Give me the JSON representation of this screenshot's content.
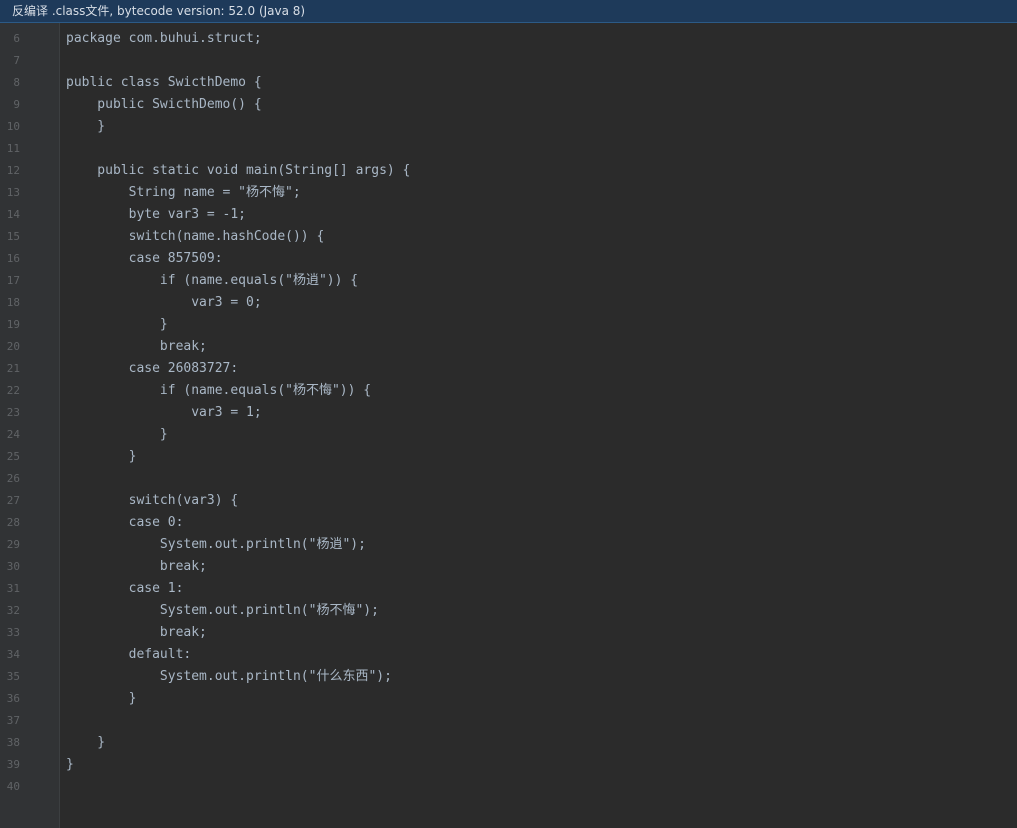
{
  "banner": {
    "text": "反编译 .class文件, bytecode version: 52.0 (Java 8)"
  },
  "editor": {
    "lines": [
      {
        "num": "6",
        "code": "package com.buhui.struct;"
      },
      {
        "num": "7",
        "code": ""
      },
      {
        "num": "8",
        "code": "public class SwicthDemo {"
      },
      {
        "num": "9",
        "code": "    public SwicthDemo() {"
      },
      {
        "num": "10",
        "code": "    }"
      },
      {
        "num": "11",
        "code": ""
      },
      {
        "num": "12",
        "code": "    public static void main(String[] args) {"
      },
      {
        "num": "13",
        "code": "        String name = \"杨不悔\";"
      },
      {
        "num": "14",
        "code": "        byte var3 = -1;"
      },
      {
        "num": "15",
        "code": "        switch(name.hashCode()) {"
      },
      {
        "num": "16",
        "code": "        case 857509:"
      },
      {
        "num": "17",
        "code": "            if (name.equals(\"杨逍\")) {"
      },
      {
        "num": "18",
        "code": "                var3 = 0;"
      },
      {
        "num": "19",
        "code": "            }"
      },
      {
        "num": "20",
        "code": "            break;"
      },
      {
        "num": "21",
        "code": "        case 26083727:"
      },
      {
        "num": "22",
        "code": "            if (name.equals(\"杨不悔\")) {"
      },
      {
        "num": "23",
        "code": "                var3 = 1;"
      },
      {
        "num": "24",
        "code": "            }"
      },
      {
        "num": "25",
        "code": "        }"
      },
      {
        "num": "26",
        "code": ""
      },
      {
        "num": "27",
        "code": "        switch(var3) {"
      },
      {
        "num": "28",
        "code": "        case 0:"
      },
      {
        "num": "29",
        "code": "            System.out.println(\"杨逍\");"
      },
      {
        "num": "30",
        "code": "            break;"
      },
      {
        "num": "31",
        "code": "        case 1:"
      },
      {
        "num": "32",
        "code": "            System.out.println(\"杨不悔\");"
      },
      {
        "num": "33",
        "code": "            break;"
      },
      {
        "num": "34",
        "code": "        default:"
      },
      {
        "num": "35",
        "code": "            System.out.println(\"什么东西\");"
      },
      {
        "num": "36",
        "code": "        }"
      },
      {
        "num": "37",
        "code": ""
      },
      {
        "num": "38",
        "code": "    }"
      },
      {
        "num": "39",
        "code": "}"
      },
      {
        "num": "40",
        "code": ""
      }
    ]
  }
}
